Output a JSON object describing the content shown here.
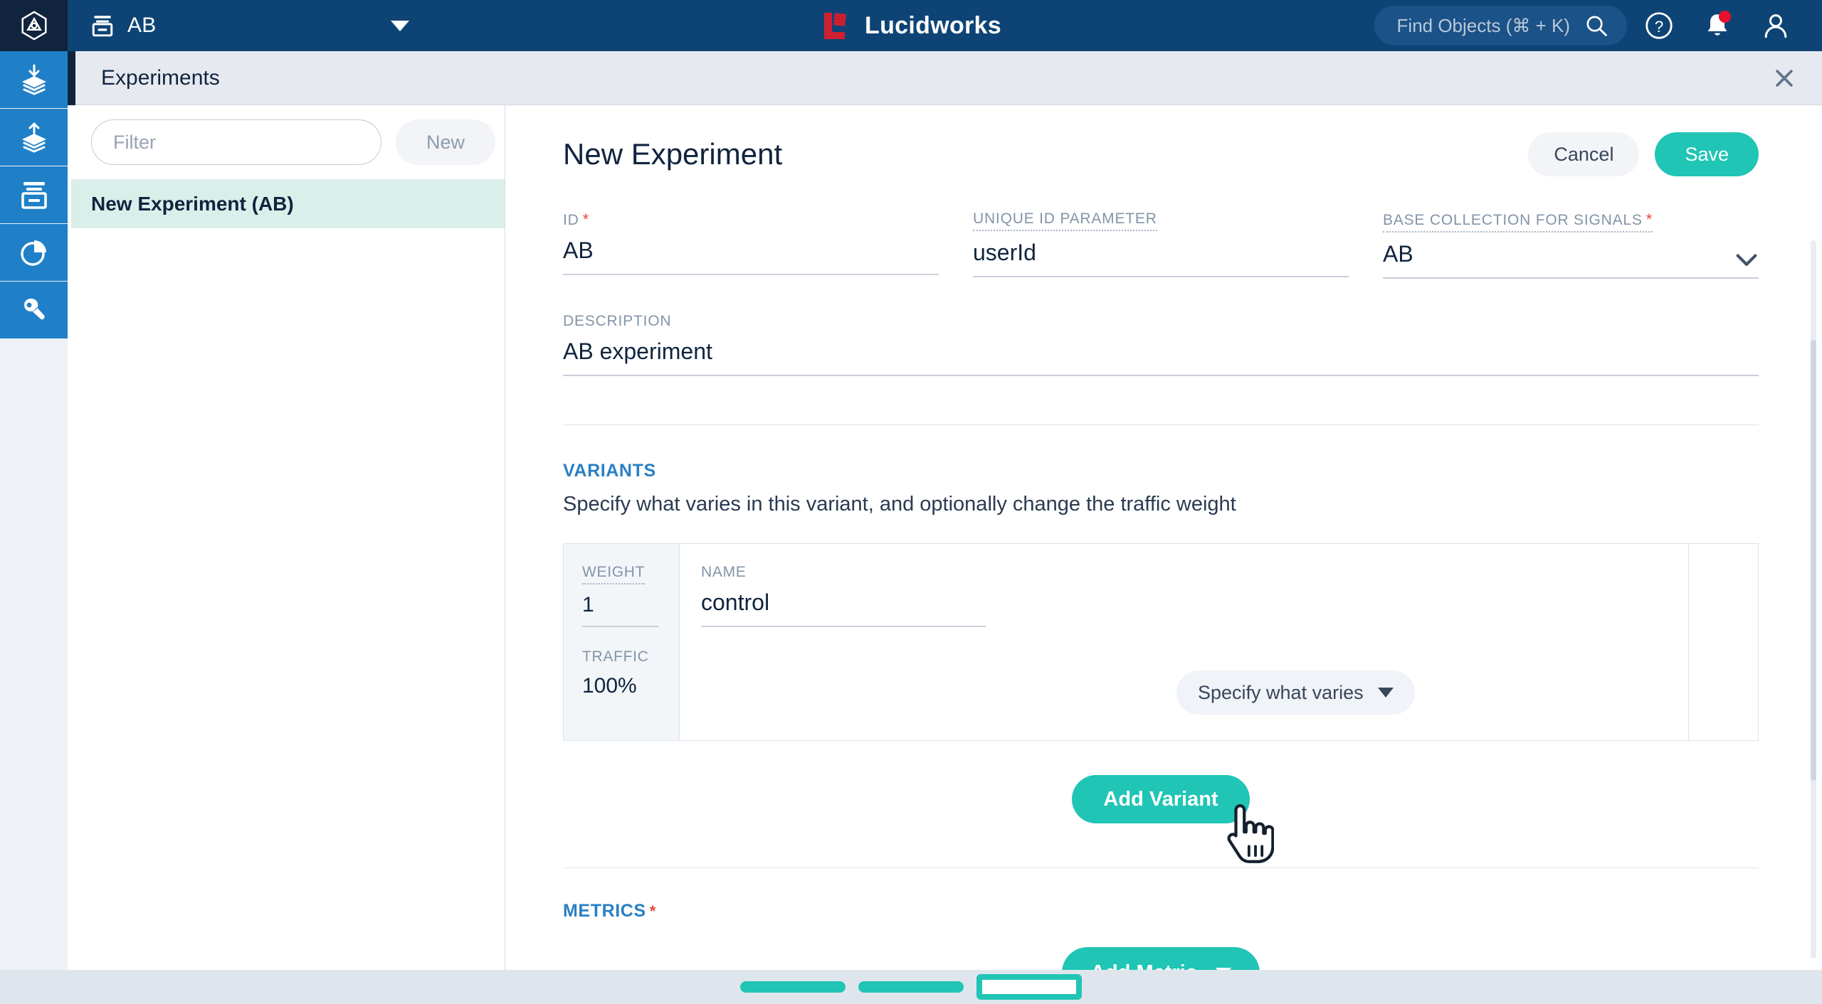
{
  "topbar": {
    "logo_icon": "lucidworks-hexagon-logo",
    "collection_icon": "collection-archive-icon",
    "collection_name": "AB",
    "collection_caret_icon": "caret-down-icon",
    "brand_name": "Lucidworks",
    "brand_icon": "lucidworks-mark",
    "find_objects_label": "Find Objects (⌘ + K)",
    "search_icon": "search-icon",
    "help_icon": "help-circle-icon",
    "notifications_icon": "bell-icon",
    "account_icon": "user-avatar-icon",
    "background_color": "#0e4475"
  },
  "rail": {
    "items": [
      {
        "name": "indexing",
        "icon": "layers-down-arrow-icon"
      },
      {
        "name": "querying",
        "icon": "layers-up-arrow-icon"
      },
      {
        "name": "collections",
        "icon": "collection-archive-icon"
      },
      {
        "name": "analytics",
        "icon": "pie-chart-icon"
      },
      {
        "name": "tools",
        "icon": "wrench-icon"
      }
    ],
    "item_color": "#1f80c8"
  },
  "panel": {
    "title": "Experiments",
    "close_icon": "close-x-icon"
  },
  "list": {
    "filter_placeholder": "Filter",
    "filter_value": "",
    "search_icon": "search-icon",
    "new_label": "New",
    "items": [
      {
        "label": "New Experiment (AB)",
        "selected": true
      }
    ],
    "selected_bg": "#d9efea"
  },
  "form": {
    "title": "New Experiment",
    "cancel_label": "Cancel",
    "save_label": "Save",
    "fields": [
      {
        "label": "ID",
        "value": "AB",
        "required": true,
        "hinted": false
      },
      {
        "label": "Unique ID Parameter",
        "value": "userId",
        "required": false,
        "hinted": true
      },
      {
        "label": "Base Collection for Signals",
        "value": "AB",
        "required": true,
        "hinted": true,
        "type": "select",
        "chevron_icon": "chevron-down-icon"
      },
      {
        "label": "Description",
        "value": "AB experiment",
        "required": false,
        "hinted": false
      }
    ],
    "variants": {
      "section_label": "Variants",
      "description": "Specify what varies in this variant, and optionally change the traffic weight",
      "weight_label": "Weight",
      "traffic_label": "Traffic",
      "name_label": "Name",
      "rows": [
        {
          "weight": "1",
          "traffic": "100%",
          "name": "control"
        }
      ],
      "specify_label": "Specify what varies",
      "specify_caret_icon": "caret-down-icon",
      "add_variant_label": "Add Variant"
    },
    "metrics": {
      "section_label": "Metrics",
      "required": true,
      "add_metric_label": "Add Metric",
      "add_metric_caret_icon": "caret-down-icon"
    },
    "accent_teal": "#20c5b5",
    "accent_blue": "#2a7fc4",
    "required_color": "#e8453c"
  },
  "cursor": {
    "icon": "pointing-hand-cursor"
  },
  "bottombar": {
    "tabs": [
      {
        "name": "tab-1",
        "active": false
      },
      {
        "name": "tab-2",
        "active": false
      },
      {
        "name": "tab-3",
        "active": true
      }
    ],
    "color": "#20c5b5"
  }
}
